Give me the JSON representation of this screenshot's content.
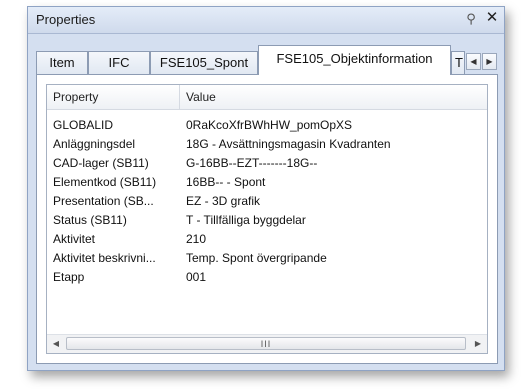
{
  "window": {
    "title": "Properties",
    "pin_glyph": "⚲",
    "close_glyph": "✕"
  },
  "tabs": [
    {
      "label": "Item",
      "active": false
    },
    {
      "label": "IFC",
      "active": false
    },
    {
      "label": "FSE105_Spont",
      "active": false
    },
    {
      "label": "FSE105_Objektinformation",
      "active": true
    },
    {
      "label": "T",
      "active": false
    }
  ],
  "tab_scroll": {
    "left_glyph": "◀",
    "right_glyph": "▶"
  },
  "grid": {
    "columns": [
      "Property",
      "Value"
    ],
    "rows": [
      {
        "property": "GLOBALID",
        "value": "0RaKcoXfrBWhHW_pomOpXS"
      },
      {
        "property": "Anläggningsdel",
        "value": "18G - Avsättningsmagasin Kvadranten"
      },
      {
        "property": "CAD-lager (SB11)",
        "value": "G-16BB--EZT-------18G--"
      },
      {
        "property": "Elementkod (SB11)",
        "value": "16BB-- - Spont"
      },
      {
        "property": "Presentation (SB...",
        "value": "EZ - 3D grafik"
      },
      {
        "property": "Status (SB11)",
        "value": "T - Tillfälliga byggdelar"
      },
      {
        "property": "Aktivitet",
        "value": "210"
      },
      {
        "property": "Aktivitet beskrivni...",
        "value": "Temp. Spont övergripande"
      },
      {
        "property": "Etapp",
        "value": "001"
      }
    ]
  },
  "scrollbar": {
    "left_glyph": "◀",
    "right_glyph": "▶",
    "grip": "III"
  }
}
